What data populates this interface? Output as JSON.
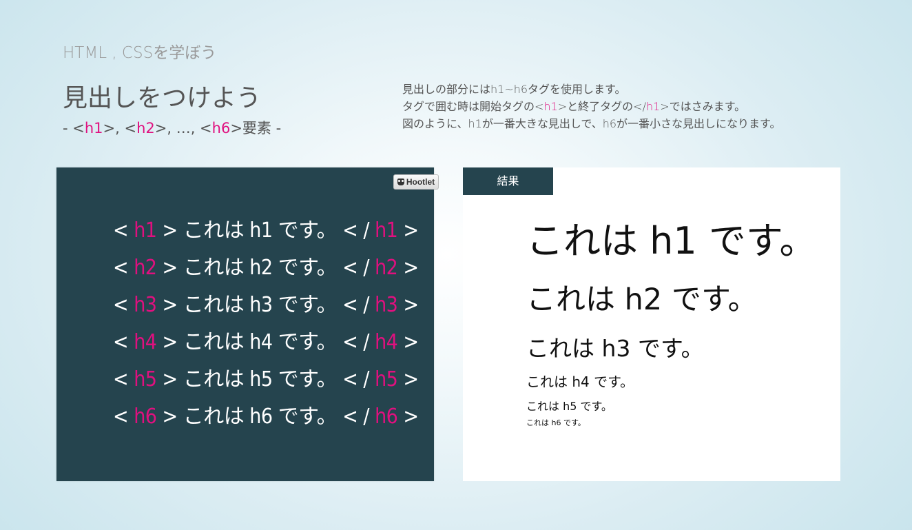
{
  "header": {
    "course": "HTML , CSSを学ぼう",
    "title": "見出しをつけよう",
    "subtitle": {
      "prefix": "- <",
      "t1": "h1",
      "sep1": ">, <",
      "t2": "h2",
      "sep2": ">, …, <",
      "t3": "h6",
      "suffix": ">要素 -"
    }
  },
  "description": {
    "line1": "見出しの部分にはh1~h6タグを使用します。",
    "line2_a": "タグで囲む時は開始タグの<",
    "line2_tag1": "h1",
    "line2_b": ">と終了タグの</",
    "line2_tag2": "h1",
    "line2_c": ">ではさみます。",
    "line3": "図のように、h1が一番大きな見出しで、h6が一番小さな見出しになります。"
  },
  "code_panel": {
    "hootlet_label": "Hootlet",
    "lines": [
      {
        "open": "< ",
        "tag": "h1",
        "mid": " > これは h1 です。 < / ",
        "tag2": "h1",
        "close": " >"
      },
      {
        "open": "< ",
        "tag": "h2",
        "mid": " > これは h2 です。 < / ",
        "tag2": "h2",
        "close": " >"
      },
      {
        "open": "< ",
        "tag": "h3",
        "mid": " > これは h3 です。 < / ",
        "tag2": "h3",
        "close": " >"
      },
      {
        "open": "< ",
        "tag": "h4",
        "mid": " > これは h4 です。 < / ",
        "tag2": "h4",
        "close": " >"
      },
      {
        "open": "< ",
        "tag": "h5",
        "mid": " > これは h5 です。 < / ",
        "tag2": "h5",
        "close": " >"
      },
      {
        "open": "< ",
        "tag": "h6",
        "mid": " > これは h6 です。 < / ",
        "tag2": "h6",
        "close": " >"
      }
    ]
  },
  "result_panel": {
    "tab_label": "結果",
    "headings": [
      "これは h1 です。",
      "これは h2 です。",
      "これは h3 です。",
      "これは h4 です。",
      "これは h5 です。",
      "これは h6 です。"
    ]
  },
  "colors": {
    "accent": "#e0107f",
    "panel_dark": "#25444e"
  }
}
